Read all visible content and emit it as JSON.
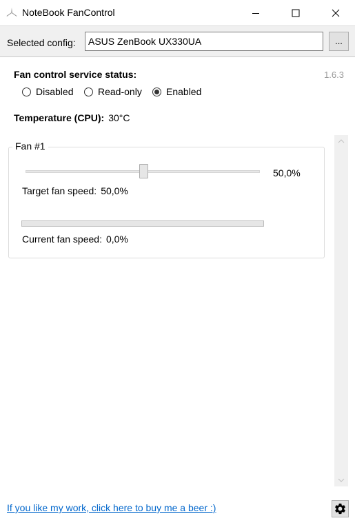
{
  "window": {
    "title": "NoteBook FanControl",
    "icon": "fan-app-icon"
  },
  "config": {
    "label": "Selected config:",
    "value": "ASUS ZenBook UX330UA",
    "browse_label": "..."
  },
  "service": {
    "title": "Fan control service status:",
    "version": "1.6.3",
    "options": [
      "Disabled",
      "Read-only",
      "Enabled"
    ],
    "selected": "Enabled"
  },
  "temperature": {
    "label": "Temperature (CPU):",
    "value": "30°C"
  },
  "fans": [
    {
      "title": "Fan #1",
      "slider_value_label": "50,0%",
      "slider_level": 0.5,
      "target_label": "Target fan speed:",
      "target_value": "50,0%",
      "current_label": "Current fan speed:",
      "current_value": "0,0%",
      "current_level": 0.0
    }
  ],
  "footer": {
    "donate_link": "If you like my work, click here to buy me a beer :)",
    "settings_icon": "gear-icon"
  },
  "colors": {
    "link": "#0066cc",
    "progress": "#06b025"
  }
}
